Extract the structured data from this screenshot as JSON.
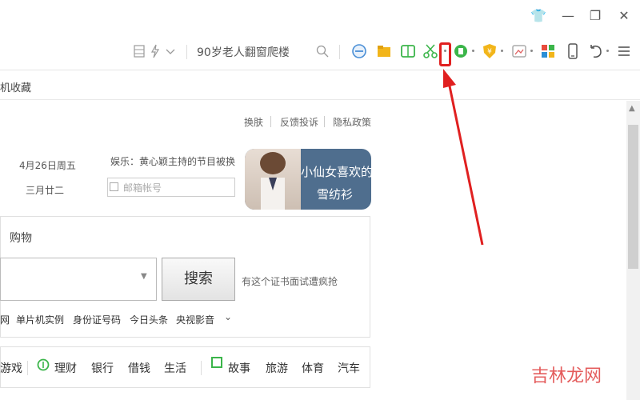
{
  "window": {
    "buttons": [
      "👕",
      "—",
      "❐",
      "✕"
    ]
  },
  "toolbar": {
    "search_text": "90岁老人翻窗爬楼",
    "accent": "#e02020"
  },
  "bookmarks": {
    "label": "机收藏"
  },
  "top_links": [
    "换肤",
    "反馈投诉",
    "隐私政策"
  ],
  "info": {
    "date_line1": "4月26日周五",
    "date_line2": "三月廿二",
    "news": "娱乐：黄心颖主持的节目被换",
    "email_placeholder": "邮箱帐号"
  },
  "banner": {
    "line1": "小仙女喜欢的",
    "line2": "雪纺衫"
  },
  "shopping": {
    "label": "购物",
    "search_button": "搜索",
    "promo": "有这个证书面试遭疯抢",
    "hot": [
      "网",
      "单片机实例",
      "身份证号码",
      "今日头条",
      "央视影音"
    ],
    "more": "⌄"
  },
  "categories": [
    "游戏",
    "理财",
    "银行",
    "借钱",
    "生活",
    "故事",
    "旅游",
    "体育",
    "汽车"
  ],
  "watermark": "吉林龙网"
}
